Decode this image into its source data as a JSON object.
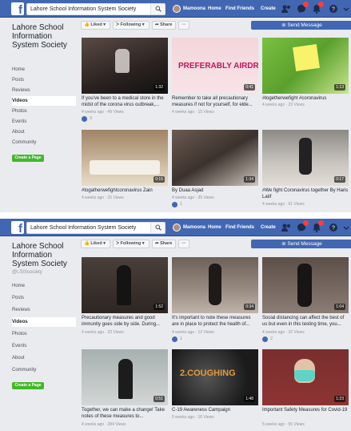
{
  "shot1": {
    "search_value": "Lahore School Information System Society",
    "nav": {
      "user": "Mamoona",
      "home": "Home",
      "find_friends": "Find Friends",
      "create": "Create"
    },
    "page_name": "Lahore School Information System Society",
    "sidebar": [
      "Home",
      "Posts",
      "Reviews",
      "Videos",
      "Photos",
      "Events",
      "About",
      "Community"
    ],
    "active_item": "Videos",
    "create_page": "Create a Page",
    "actions": {
      "liked": "Liked ▾",
      "following": "Following ▾",
      "share": "Share",
      "more": "···"
    },
    "send_message": "Send Message",
    "videos": [
      {
        "title": "If you've been to a medical store in the midst of the corona virus outbreak,...",
        "meta": "4 weeks ago · 49 Views",
        "duration": "1:32",
        "reactions": "3"
      },
      {
        "title": "Remember to take all precautionary measures if not for yourself, for elde...",
        "meta": "4 weeks ago · 15 Views",
        "duration": "0:41",
        "overlay": "PREFERABLY AIRDRY"
      },
      {
        "title": "#togetherwefight #coronavirus",
        "meta": "4 weeks ago · 23 Views",
        "duration": "1:13"
      },
      {
        "title": "#togatherwefightcoronavirus Zain",
        "meta": "4 weeks ago · 15 Views",
        "duration": "0:15"
      },
      {
        "title": "By Duaa Asjad",
        "meta": "4 weeks ago · 35 Views",
        "duration": "1:34",
        "reactions": "1"
      },
      {
        "title": "#We fight Coronavirus together By Haris Latif",
        "meta": "4 weeks ago · 61 Views",
        "duration": "0:17"
      }
    ]
  },
  "shot2": {
    "search_value": "Lahore School Information System Society",
    "nav": {
      "user": "Mamoona",
      "home": "Home",
      "find_friends": "Find Friends",
      "create": "Create"
    },
    "page_name": "Lahore School Information System Society",
    "handle": "@LSISsociety",
    "sidebar": [
      "Home",
      "Posts",
      "Reviews",
      "Videos",
      "Photos",
      "Events",
      "About",
      "Community"
    ],
    "active_item": "Videos",
    "create_page": "Create a Page",
    "actions": {
      "liked": "Liked ▾",
      "following": "Following ▾",
      "share": "Share",
      "more": "···"
    },
    "send_message": "Send Message",
    "videos": [
      {
        "title": "Precautionary measures and good immunity goes side by side. During...",
        "meta": "4 weeks ago · 23 Views",
        "duration": "1:52"
      },
      {
        "title": "It's important to note these measures are in place to protect the health of...",
        "meta": "4 weeks ago · 12 Views",
        "duration": "0:34",
        "reactions": "1"
      },
      {
        "title": "Social distancing can affect the best of us but even in this testing time, you...",
        "meta": "4 weeks ago · 32 Views",
        "duration": "1:04",
        "reactions": "2"
      },
      {
        "title": "Together, we can make a change! Take notes of these measures to...",
        "meta": "4 weeks ago · 284 Views",
        "duration": "0:51"
      },
      {
        "title": "C-19 Awareness Campaign",
        "meta": "5 weeks ago · 16 Views",
        "duration": "1:48",
        "overlay": "2.COUGHING"
      },
      {
        "title": "Important Safety Measures for Covid-19",
        "meta": "5 weeks ago · 55 Views",
        "duration": "1:23"
      }
    ]
  },
  "colors": {
    "brand": "#4267b2",
    "page_bg": "#e9ebee",
    "create_green": "#42b72a",
    "badge_red": "#fa3e3e"
  }
}
